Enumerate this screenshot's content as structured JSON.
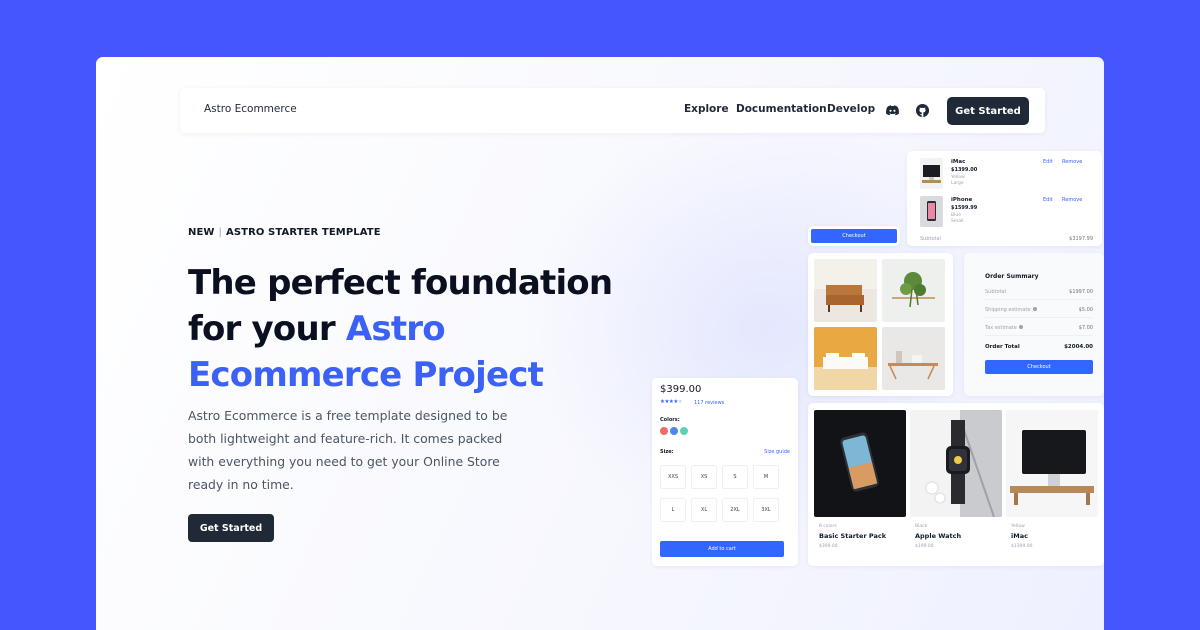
{
  "nav": {
    "brand": "Astro Ecommerce",
    "links": [
      "Explore",
      "Documentation",
      "Develop"
    ],
    "icons": [
      "discord-icon",
      "github-icon"
    ],
    "cta": "Get Started"
  },
  "hero": {
    "eyebrow_new": "NEW",
    "eyebrow_sep": "|",
    "eyebrow_tag": "ASTRO STARTER TEMPLATE",
    "headline_line1": "The perfect foundation",
    "headline_line2_plain": "for your",
    "headline_line2_accent": "Astro",
    "headline_line3_accent": "Ecommerce Project",
    "description": "Astro Ecommerce is a free template designed to be both lightweight and feature-rich. It comes packed with everything you need to get your Online Store ready in no time.",
    "cta": "Get Started"
  },
  "colors": {
    "background": "#4656ff",
    "accent": "#3b61f6",
    "dark_button": "#1f2937",
    "primary_button": "#3366ff"
  },
  "mockup": {
    "cart": {
      "items": [
        {
          "name": "iMac",
          "price": "$1399.00",
          "color": "Yellow",
          "size": "Large",
          "edit": "Edit",
          "remove": "Remove"
        },
        {
          "name": "iPhone",
          "price": "$1599.99",
          "color": "Blue",
          "size": "Small",
          "edit": "Edit",
          "remove": "Remove"
        }
      ],
      "subtotal_label": "Subtotal",
      "subtotal_value": "$3197.99"
    },
    "checkout_button": "Checkout",
    "order_summary": {
      "title": "Order Summary",
      "rows": [
        {
          "label": "Subtotal",
          "value": "$1997.00"
        },
        {
          "label": "Shipping estimate",
          "value": "$5.00"
        },
        {
          "label": "Tax estimate",
          "value": "$7.00"
        }
      ],
      "total_label": "Order Total",
      "total_value": "$2004.00",
      "button": "Checkout"
    },
    "product_detail": {
      "price": "$399.00",
      "rating": 4,
      "reviews": "117 reviews",
      "colors_label": "Colors:",
      "swatches": [
        "#f06a6a",
        "#4f86e8",
        "#5ad1b8"
      ],
      "size_label": "Size:",
      "size_guide": "Size guide",
      "sizes": [
        "XXS",
        "XS",
        "S",
        "M",
        "L",
        "XL",
        "2XL",
        "3XL"
      ],
      "add_to_cart": "Add to cart"
    },
    "products": [
      {
        "color": "8 colors",
        "name": "Basic Starter Pack",
        "price": "$399.00"
      },
      {
        "color": "Black",
        "name": "Apple Watch",
        "price": "$199.00"
      },
      {
        "color": "Yellow",
        "name": "iMac",
        "price": "$1399.00"
      }
    ]
  }
}
